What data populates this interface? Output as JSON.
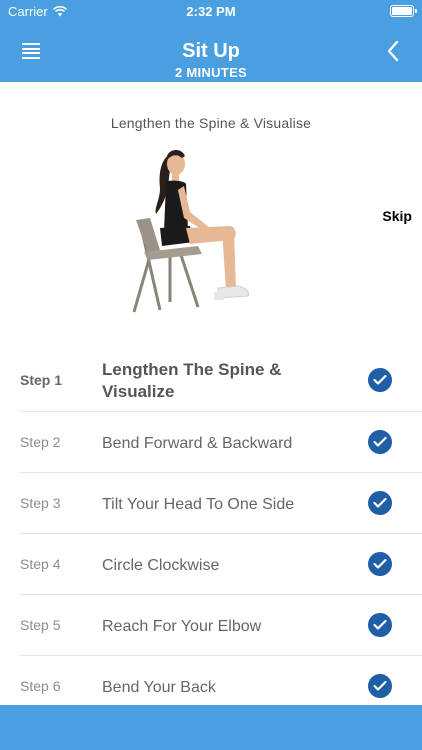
{
  "status_bar": {
    "carrier": "Carrier",
    "time": "2:32 PM"
  },
  "header": {
    "title": "Sit Up",
    "subtitle": "2 MINUTES"
  },
  "hero": {
    "caption": "Lengthen the Spine & Visualise",
    "skip_label": "Skip"
  },
  "steps": [
    {
      "number": "Step 1",
      "title": "Lengthen The Spine & Visualize",
      "completed": true
    },
    {
      "number": "Step 2",
      "title": "Bend Forward & Backward",
      "completed": true
    },
    {
      "number": "Step 3",
      "title": "Tilt Your Head To One Side",
      "completed": true
    },
    {
      "number": "Step 4",
      "title": "Circle Clockwise",
      "completed": true
    },
    {
      "number": "Step 5",
      "title": "Reach For Your Elbow",
      "completed": true
    },
    {
      "number": "Step 6",
      "title": "Bend Your Back",
      "completed": true
    }
  ],
  "colors": {
    "accent": "#4a9fe0",
    "check": "#1f5fa6"
  }
}
